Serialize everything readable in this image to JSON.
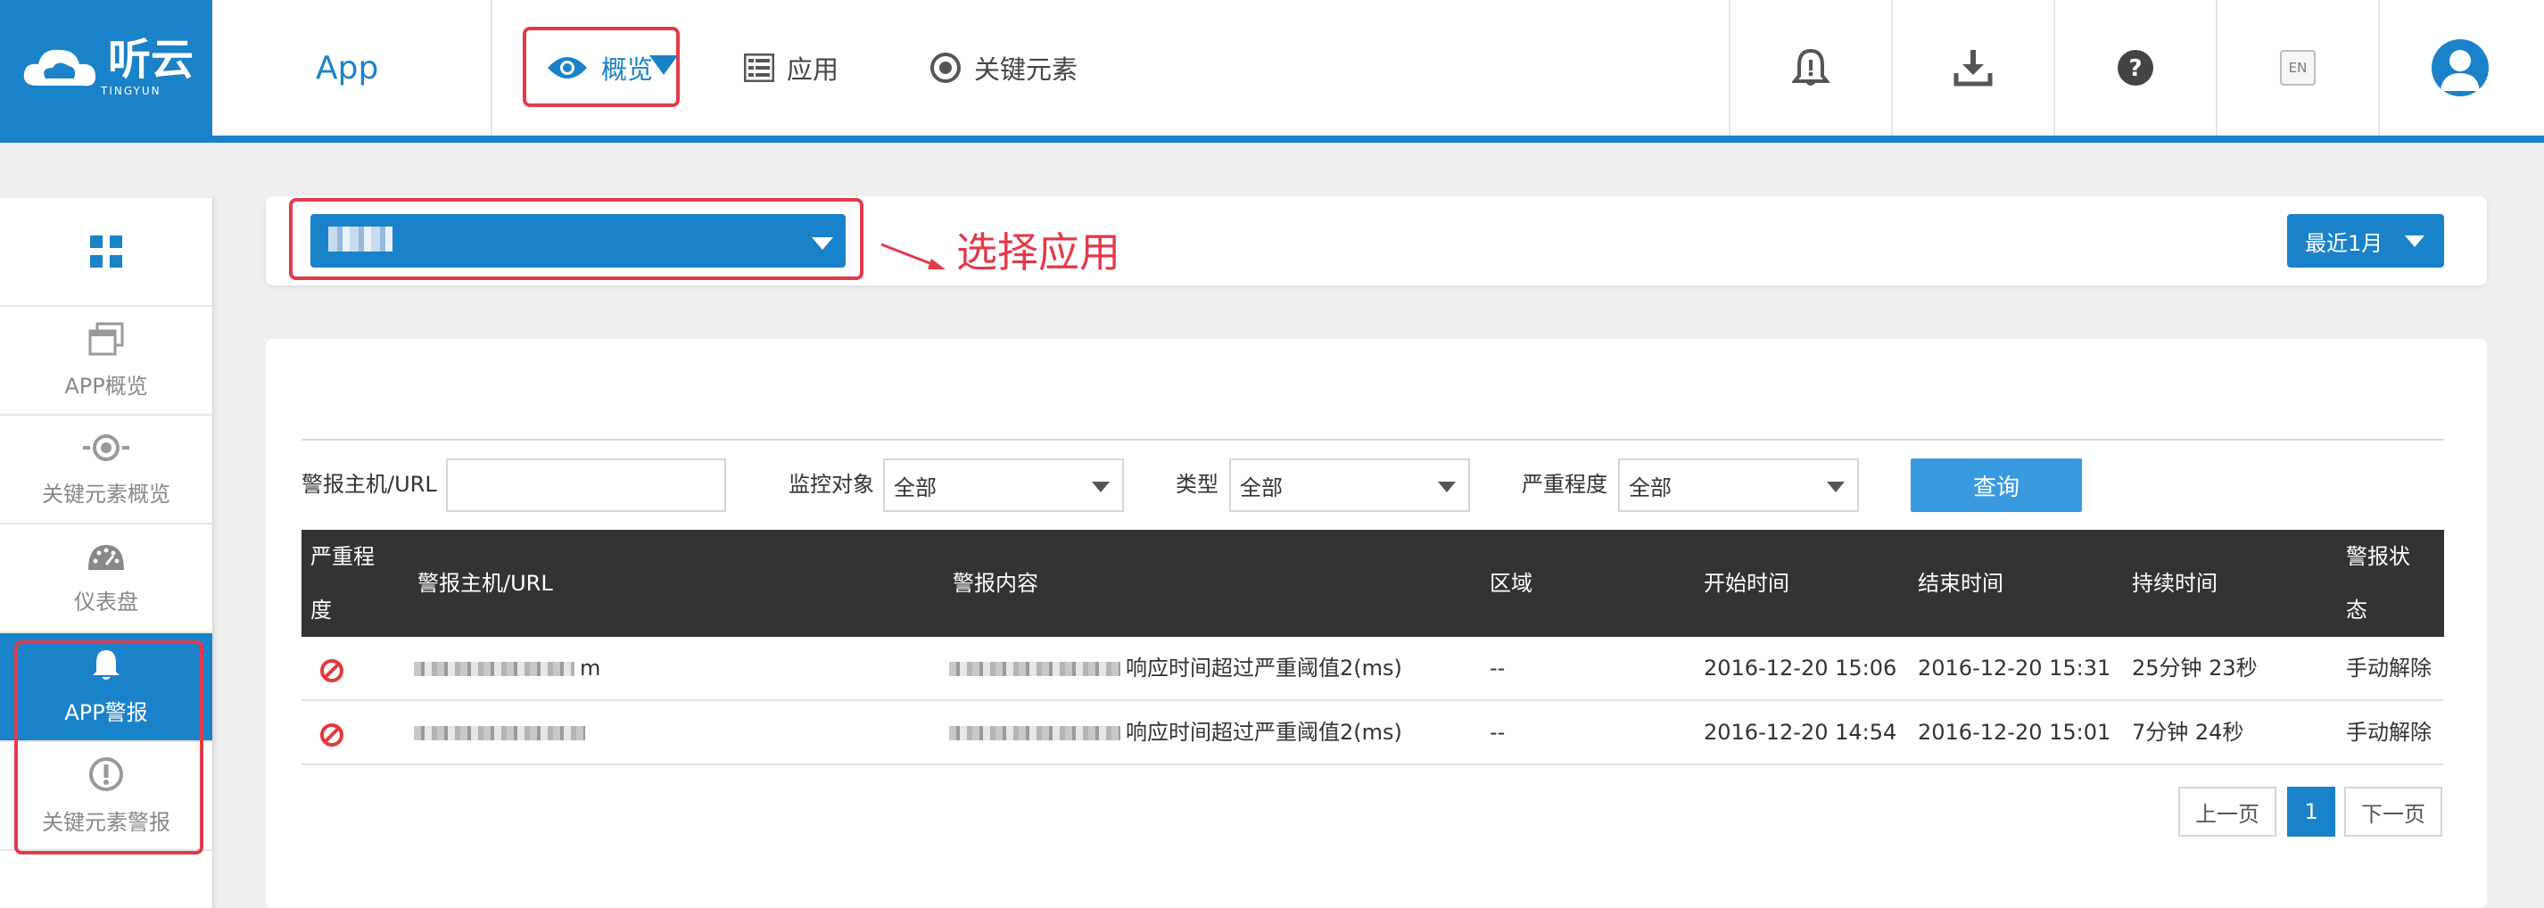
{
  "brand": {
    "logo_text": "听云",
    "logo_sub": "TINGYUN"
  },
  "header": {
    "app_selector": "App",
    "nav": [
      {
        "label": "概览",
        "icon": "eye-icon",
        "active": true
      },
      {
        "label": "应用",
        "icon": "list-icon"
      },
      {
        "label": "关键元素",
        "icon": "target-icon"
      }
    ],
    "tools": {
      "alert": "bell-icon",
      "download": "download-icon",
      "help": "help-icon",
      "language": "EN",
      "user": "user-icon"
    }
  },
  "sidebar": {
    "items": [
      {
        "label": "",
        "icon": "grid-icon"
      },
      {
        "label": "APP概览",
        "icon": "windows-icon"
      },
      {
        "label": "关键元素概览",
        "icon": "target-icon"
      },
      {
        "label": "仪表盘",
        "icon": "gauge-icon"
      },
      {
        "label": "APP警报",
        "icon": "bell-icon",
        "active": true
      },
      {
        "label": "关键元素警报",
        "icon": "exclamation-icon"
      }
    ]
  },
  "toolbar": {
    "annotation": "选择应用",
    "time_range": "最近1月"
  },
  "filters": {
    "host_label": "警报主机/URL",
    "host_value": "",
    "monitor_label": "监控对象",
    "monitor_value": "全部",
    "type_label": "类型",
    "type_value": "全部",
    "severity_label": "严重程度",
    "severity_value": "全部",
    "query_label": "查询"
  },
  "table": {
    "headers": {
      "severity_l1": "严重程",
      "severity_l2": "度",
      "host": "警报主机/URL",
      "content": "警报内容",
      "region": "区域",
      "start": "开始时间",
      "end": "结束时间",
      "duration": "持续时间",
      "status_l1": "警报状",
      "status_l2": "态"
    },
    "rows": [
      {
        "host_suffix": "m",
        "content": "响应时间超过严重阈值2(ms)",
        "region": "--",
        "start": "2016-12-20 15:06",
        "end": "2016-12-20 15:31",
        "duration": "25分钟 23秒",
        "status": "手动解除"
      },
      {
        "host_suffix": "",
        "content": "响应时间超过严重阈值2(ms)",
        "region": "--",
        "start": "2016-12-20 14:54",
        "end": "2016-12-20 15:01",
        "duration": "7分钟 24秒",
        "status": "手动解除"
      }
    ]
  },
  "pagination": {
    "prev": "上一页",
    "current": "1",
    "next": "下一页"
  },
  "colors": {
    "brand_blue": "#1a82c8",
    "annotation_red": "#e23a4a",
    "header_dark": "#333333"
  }
}
